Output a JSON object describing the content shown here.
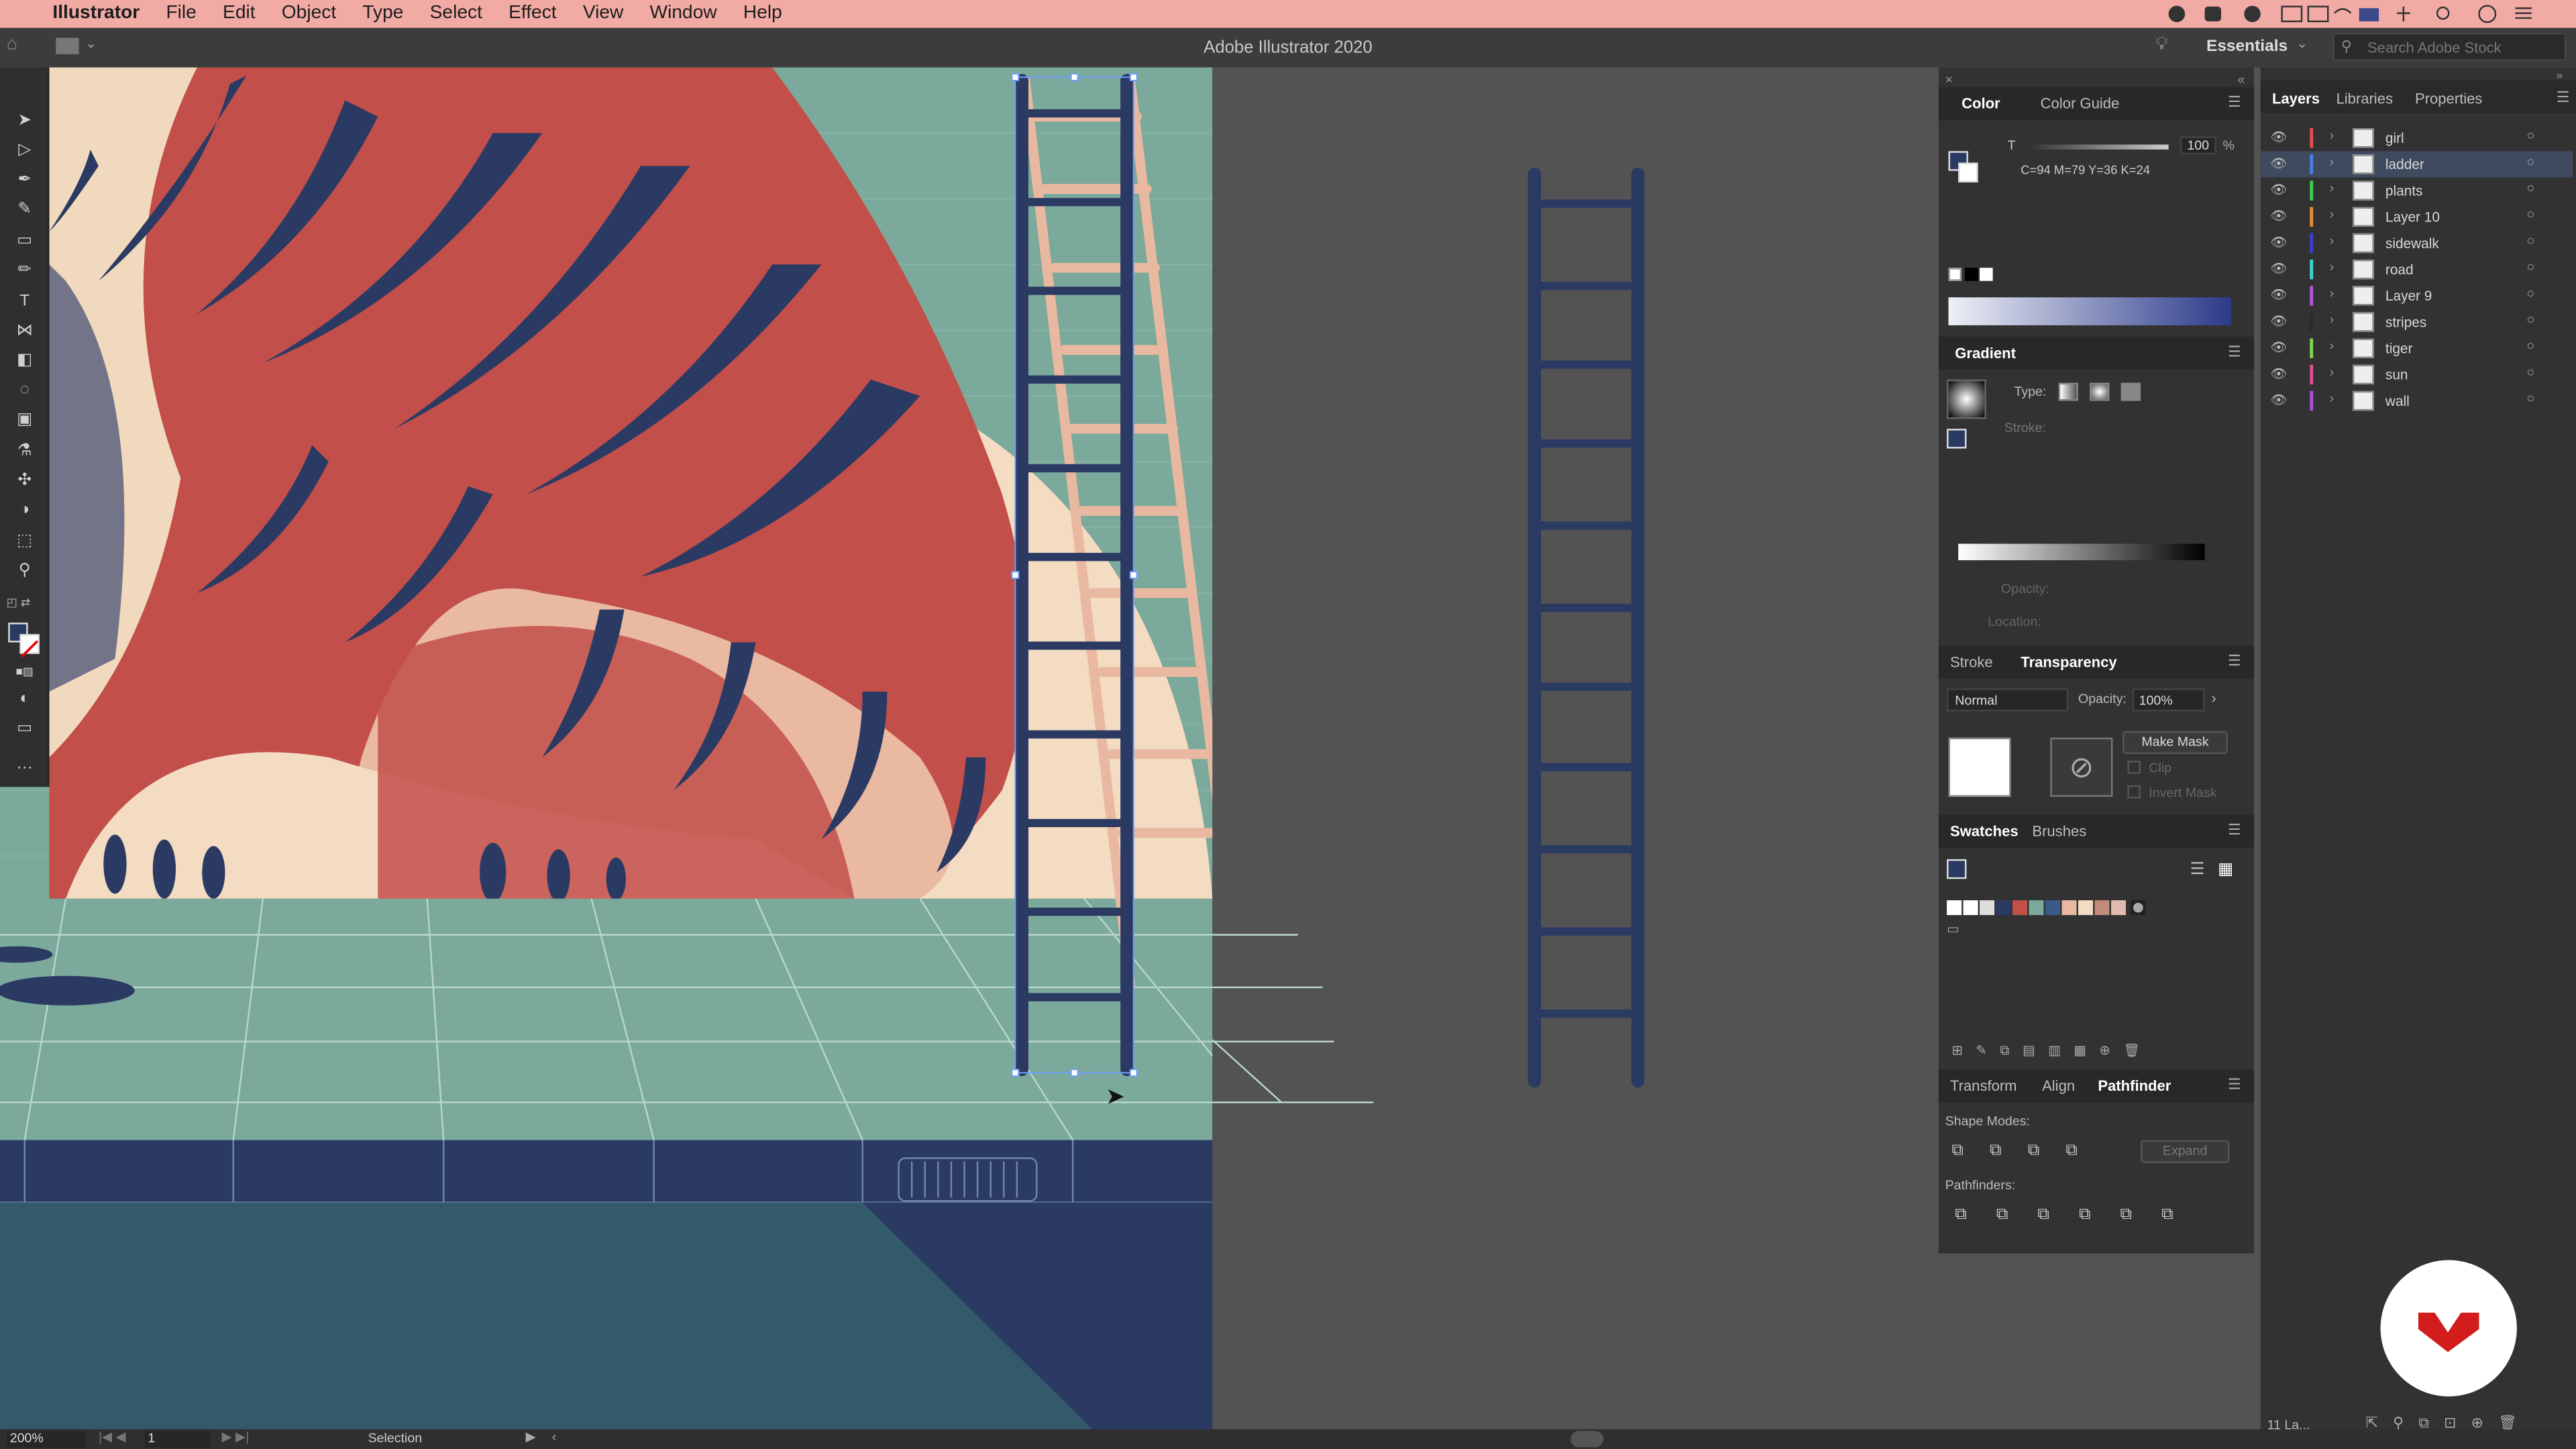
{
  "menubar": {
    "app": "Illustrator",
    "items": [
      "File",
      "Edit",
      "Object",
      "Type",
      "Select",
      "Effect",
      "View",
      "Window",
      "Help"
    ]
  },
  "titlebar": {
    "title": "Adobe Illustrator 2020",
    "workspace": "Essentials",
    "search_placeholder": "Search Adobe Stock"
  },
  "statusbar": {
    "zoom": "200%",
    "artboard": "1",
    "tool": "Selection",
    "layers_count": "11 La..."
  },
  "color_panel": {
    "tabs": [
      "Color",
      "Color Guide"
    ],
    "t_label": "T",
    "t_value": "100",
    "percent": "%",
    "cmyk": "C=94 M=79 Y=36 K=24"
  },
  "gradient_panel": {
    "title": "Gradient",
    "type_label": "Type:",
    "stroke_label": "Stroke:",
    "opacity_label": "Opacity:",
    "location_label": "Location:"
  },
  "transparency_panel": {
    "tabs": [
      "Stroke",
      "Transparency"
    ],
    "blend_mode": "Normal",
    "opacity_label": "Opacity:",
    "opacity_value": "100%",
    "make_mask": "Make Mask",
    "clip": "Clip",
    "invert_mask": "Invert Mask"
  },
  "swatches_panel": {
    "tabs": [
      "Swatches",
      "Brushes"
    ]
  },
  "pathfinder_panel": {
    "tabs": [
      "Transform",
      "Align",
      "Pathfinder"
    ],
    "shape_modes": "Shape Modes:",
    "pathfinders": "Pathfinders:",
    "expand": "Expand"
  },
  "layers_panel": {
    "tabs": [
      "Layers",
      "Libraries",
      "Properties"
    ],
    "layers": [
      {
        "name": "girl",
        "color": "#e34f4f"
      },
      {
        "name": "ladder",
        "color": "#4a7de8"
      },
      {
        "name": "plants",
        "color": "#3fcf52"
      },
      {
        "name": "Layer 10",
        "color": "#e88b3a"
      },
      {
        "name": "sidewalk",
        "color": "#3c3cd6"
      },
      {
        "name": "road",
        "color": "#3bd4d4"
      },
      {
        "name": "Layer 9",
        "color": "#b354d6"
      },
      {
        "name": "stripes",
        "color": "#2b2b2b"
      },
      {
        "name": "tiger",
        "color": "#7ad64c"
      },
      {
        "name": "sun",
        "color": "#e04f8f"
      },
      {
        "name": "wall",
        "color": "#b04fd6"
      }
    ],
    "selected": "ladder"
  },
  "colors": {
    "menubar": "#f2aaa4",
    "tiger": "#c24f4a",
    "navy": "#2b3a62",
    "teal": "#7ba99b",
    "ladder_pink": "#e8b9a0"
  }
}
